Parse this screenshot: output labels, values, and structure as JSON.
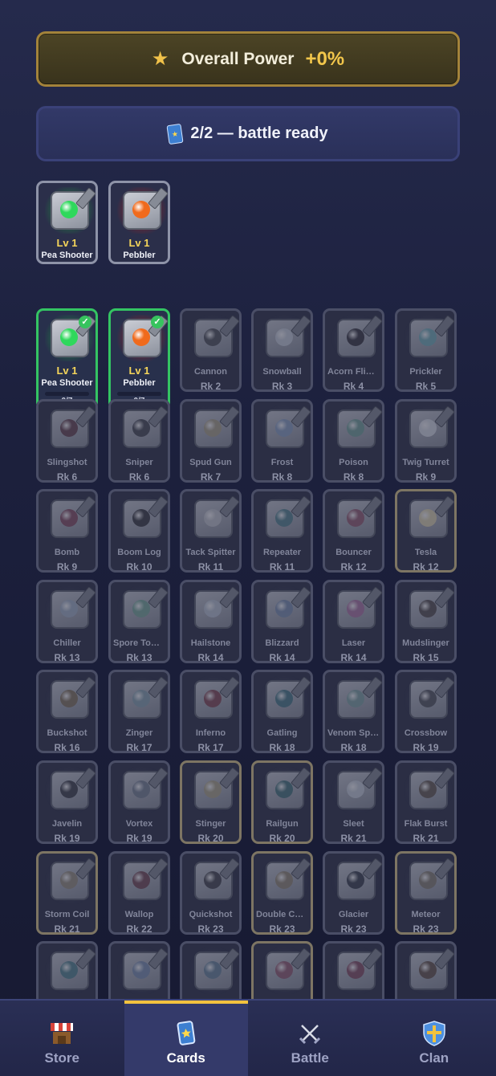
{
  "header": {
    "power_label": "Overall Power",
    "power_value": "+0%",
    "power_icon": "star-icon",
    "deck_status": "2/2 — battle ready",
    "deck_icon": "card-icon"
  },
  "deck": [
    {
      "level": "Lv 1",
      "name": "Pea Shooter",
      "core": "#2fd85c",
      "glow": "#1e9a3f"
    },
    {
      "level": "Lv 1",
      "name": "Pebbler",
      "core": "#f06a1c",
      "glow": "#b01e1e"
    }
  ],
  "collection": [
    {
      "name": "Pea Shooter",
      "level": "Lv 1",
      "progress": "0/7",
      "progress_fraction": 0,
      "owned": true,
      "core": "#2fd85c",
      "glow": "#1e9a3f"
    },
    {
      "name": "Pebbler",
      "level": "Lv 1",
      "progress": "0/7",
      "progress_fraction": 0,
      "owned": true,
      "core": "#f06a1c",
      "glow": "#b01e1e"
    },
    {
      "name": "Cannon",
      "rank": "Rk 2",
      "core": "#55575e"
    },
    {
      "name": "Snowball",
      "rank": "Rk 3",
      "core": "#cfd5df"
    },
    {
      "name": "Acorn Flinger",
      "rank": "Rk 4",
      "core": "#3c3a44"
    },
    {
      "name": "Prickler",
      "rank": "Rk 5",
      "core": "#7bb5bf"
    },
    {
      "name": "Slingshot",
      "rank": "Rk 6",
      "core": "#6b4a55"
    },
    {
      "name": "Sniper",
      "rank": "Rk 6",
      "core": "#4a4d57"
    },
    {
      "name": "Spud Gun",
      "rank": "Rk 7",
      "core": "#b0a88f"
    },
    {
      "name": "Frost",
      "rank": "Rk 8",
      "core": "#8fa6c8"
    },
    {
      "name": "Poison",
      "rank": "Rk 8",
      "core": "#7aa9a0"
    },
    {
      "name": "Twig Turret",
      "rank": "Rk 9",
      "core": "#dfe3ea"
    },
    {
      "name": "Bomb",
      "rank": "Rk 9",
      "core": "#8a5266"
    },
    {
      "name": "Boom Log",
      "rank": "Rk 10",
      "core": "#3e3f45"
    },
    {
      "name": "Tack Spitter",
      "rank": "Rk 11",
      "core": "#c9ccd2"
    },
    {
      "name": "Repeater",
      "rank": "Rk 11",
      "core": "#5a8a94"
    },
    {
      "name": "Bouncer",
      "rank": "Rk 12",
      "core": "#9a6276"
    },
    {
      "name": "Tesla",
      "rank": "Rk 12",
      "core": "#e6dcb5",
      "gold": true
    },
    {
      "name": "Chiller",
      "rank": "Rk 13",
      "core": "#a9b8cc"
    },
    {
      "name": "Spore Tower",
      "rank": "Rk 13",
      "core": "#7fb0a0"
    },
    {
      "name": "Hailstone",
      "rank": "Rk 14",
      "core": "#c0cad8"
    },
    {
      "name": "Blizzard",
      "rank": "Rk 14",
      "core": "#8296b5"
    },
    {
      "name": "Laser",
      "rank": "Rk 14",
      "core": "#b27aa8"
    },
    {
      "name": "Mudslinger",
      "rank": "Rk 15",
      "core": "#5c5656"
    },
    {
      "name": "Buckshot",
      "rank": "Rk 16",
      "core": "#8a7a62"
    },
    {
      "name": "Zinger",
      "rank": "Rk 17",
      "core": "#8fa9b5"
    },
    {
      "name": "Inferno",
      "rank": "Rk 17",
      "core": "#8a4f5a"
    },
    {
      "name": "Gatling",
      "rank": "Rk 18",
      "core": "#4f7f8c"
    },
    {
      "name": "Venom Spitter",
      "rank": "Rk 18",
      "core": "#86a9a8"
    },
    {
      "name": "Crossbow",
      "rank": "Rk 19",
      "core": "#5a5b63"
    },
    {
      "name": "Javelin",
      "rank": "Rk 19",
      "core": "#44464f"
    },
    {
      "name": "Vortex",
      "rank": "Rk 19",
      "core": "#7d8798"
    },
    {
      "name": "Stinger",
      "rank": "Rk 20",
      "core": "#b4ac8e",
      "gold": true
    },
    {
      "name": "Railgun",
      "rank": "Rk 20",
      "core": "#4d7a80",
      "gold": true
    },
    {
      "name": "Sleet",
      "rank": "Rk 21",
      "core": "#cfd6df"
    },
    {
      "name": "Flak Burst",
      "rank": "Rk 21",
      "core": "#6b6157"
    },
    {
      "name": "Storm Coil",
      "rank": "Rk 21",
      "core": "#9d9584",
      "gold": true
    },
    {
      "name": "Wallop",
      "rank": "Rk 22",
      "core": "#7a4f5a"
    },
    {
      "name": "Quickshot",
      "rank": "Rk 23",
      "core": "#4a4b52"
    },
    {
      "name": "Double Cannon",
      "rank": "Rk 23",
      "core": "#9a8f7a",
      "gold": true
    },
    {
      "name": "Glacier",
      "rank": "Rk 23",
      "core": "#3e4450"
    },
    {
      "name": "Meteor",
      "rank": "Rk 23",
      "core": "#8d8678",
      "gold": true
    },
    {
      "name": "",
      "rank": "",
      "core": "#5a8a94"
    },
    {
      "name": "",
      "rank": "",
      "core": "#8296b5"
    },
    {
      "name": "",
      "rank": "",
      "core": "#6f8aa0"
    },
    {
      "name": "",
      "rank": "",
      "core": "#9a6276",
      "gold": true
    },
    {
      "name": "",
      "rank": "",
      "core": "#8a5266"
    },
    {
      "name": "",
      "rank": "",
      "core": "#6b5a50"
    }
  ],
  "nav": [
    {
      "label": "Store",
      "icon": "store-icon",
      "active": false
    },
    {
      "label": "Cards",
      "icon": "cards-icon",
      "active": true
    },
    {
      "label": "Battle",
      "icon": "crossed-swords-icon",
      "active": false
    },
    {
      "label": "Clan",
      "icon": "shield-icon",
      "active": false
    }
  ],
  "colors": {
    "accent_gold": "#f2c23e",
    "owned_border": "#34c463",
    "background": "#1c203d"
  }
}
